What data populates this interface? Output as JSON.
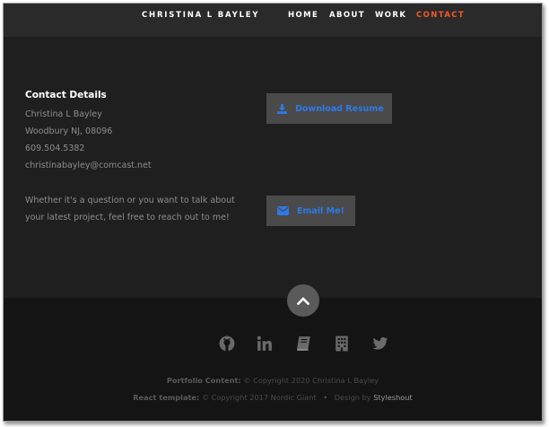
{
  "header": {
    "brand": "CHRISTINA L BAYLEY",
    "nav": [
      {
        "label": "HOME",
        "active": false
      },
      {
        "label": "ABOUT",
        "active": false
      },
      {
        "label": "WORK",
        "active": false
      },
      {
        "label": "CONTACT",
        "active": true
      }
    ],
    "active_color": "#f05a28"
  },
  "contact": {
    "title": "Contact Details",
    "name": "Christina L Bayley",
    "location": "Woodbury NJ, 08096",
    "phone": "609.504.5382",
    "email": "christinabayley@comcast.net",
    "blurb": "Whether it's a question or you want to talk about your latest project, feel free to reach out to me!",
    "download_label": "Download Resume",
    "email_label": "Email Me!",
    "button_text_color": "#2d79e8"
  },
  "footer": {
    "social_icons": [
      "github-icon",
      "linkedin-icon",
      "book-icon",
      "building-icon",
      "twitter-icon"
    ],
    "portfolio_label": "Portfolio Content:",
    "portfolio_text": "© Copyright 2020 Christina L Bayley",
    "react_label": "React template:",
    "react_text": "© Copyright 2017 Nordic Giant",
    "separator": "•",
    "design_text": "Design by",
    "design_link": "Styleshout"
  }
}
